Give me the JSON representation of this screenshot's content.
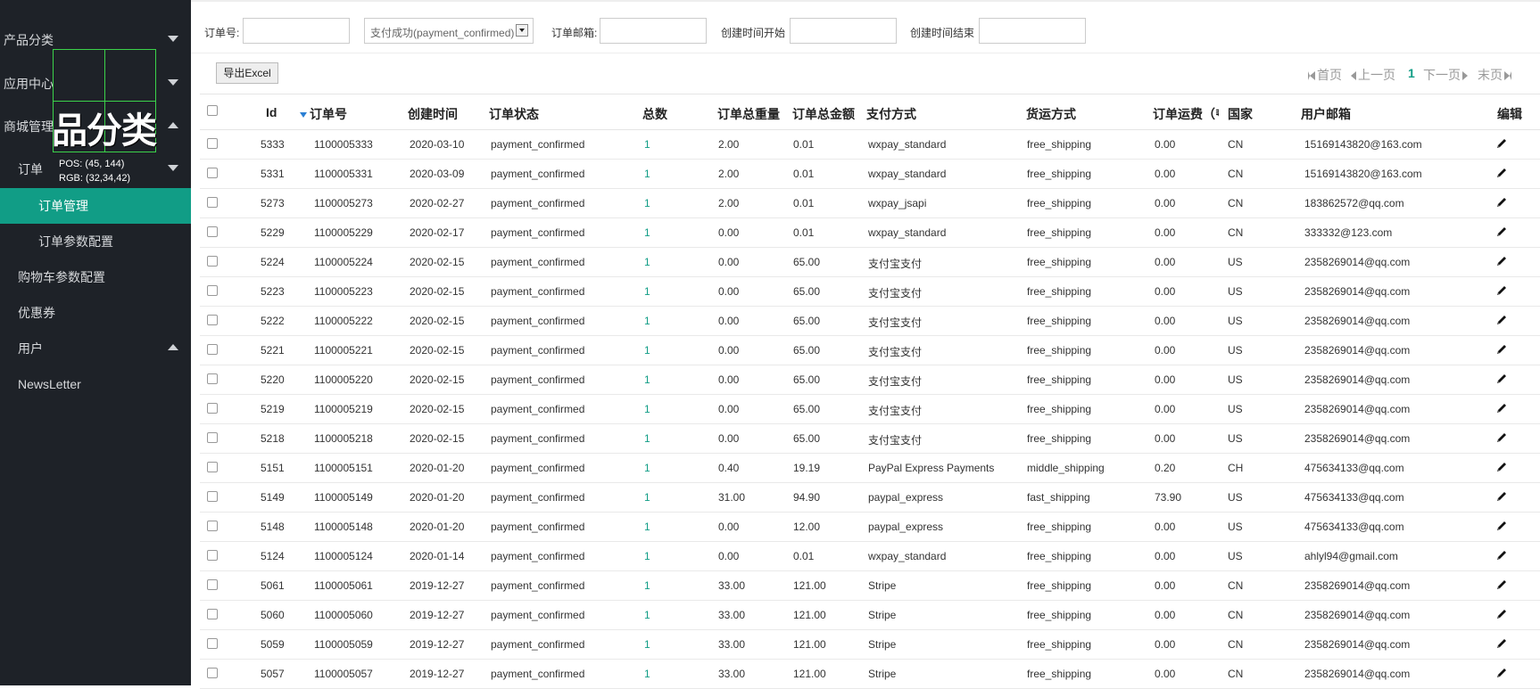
{
  "sidebar": {
    "items": [
      {
        "label": "产品分类",
        "caret": "down"
      },
      {
        "label": "应用中心",
        "caret": "down"
      },
      {
        "label": "商城管理",
        "caret": "up"
      },
      {
        "label": "订单",
        "caret": "down"
      },
      {
        "label": "订单管理",
        "active": true
      },
      {
        "label": "订单参数配置"
      },
      {
        "label": "购物车参数配置"
      },
      {
        "label": "优惠券"
      },
      {
        "label": "用户",
        "caret": "up"
      },
      {
        "label": "NewsLetter"
      }
    ]
  },
  "magnifier": {
    "zoom_text": "品分类",
    "pos": "POS:  (45, 144)",
    "rgb": "RGB:  (32,34,42)"
  },
  "filters": {
    "order_no_label": "订单号:",
    "status_value": "支付成功(payment_confirmed)",
    "email_label": "订单邮箱:",
    "start_label": "创建时间开始",
    "end_label": "创建时间结束"
  },
  "toolbar": {
    "export_label": "导出Excel",
    "first_label": "首页",
    "prev_label": "上一页",
    "current_page": "1",
    "next_label": "下一页",
    "last_label": "末页"
  },
  "table": {
    "headers": {
      "id": "Id",
      "order_no": "订单号",
      "created": "创建时间",
      "status": "订单状态",
      "count": "总数",
      "weight": "订单总重量",
      "amount": "订单总金额",
      "payment": "支付方式",
      "shipping": "货运方式",
      "fee": "订单运费（₹",
      "country": "国家",
      "email": "用户邮箱",
      "edit": "编辑"
    },
    "rows": [
      [
        "5333",
        "1100005333",
        "2020-03-10",
        "payment_confirmed",
        "1",
        "2.00",
        "0.01",
        "wxpay_standard",
        "free_shipping",
        "0.00",
        "CN",
        "15169143820@163.com"
      ],
      [
        "5331",
        "1100005331",
        "2020-03-09",
        "payment_confirmed",
        "1",
        "2.00",
        "0.01",
        "wxpay_standard",
        "free_shipping",
        "0.00",
        "CN",
        "15169143820@163.com"
      ],
      [
        "5273",
        "1100005273",
        "2020-02-27",
        "payment_confirmed",
        "1",
        "2.00",
        "0.01",
        "wxpay_jsapi",
        "free_shipping",
        "0.00",
        "CN",
        "183862572@qq.com"
      ],
      [
        "5229",
        "1100005229",
        "2020-02-17",
        "payment_confirmed",
        "1",
        "0.00",
        "0.01",
        "wxpay_standard",
        "free_shipping",
        "0.00",
        "CN",
        "333332@123.com"
      ],
      [
        "5224",
        "1100005224",
        "2020-02-15",
        "payment_confirmed",
        "1",
        "0.00",
        "65.00",
        "支付宝支付",
        "free_shipping",
        "0.00",
        "US",
        "2358269014@qq.com"
      ],
      [
        "5223",
        "1100005223",
        "2020-02-15",
        "payment_confirmed",
        "1",
        "0.00",
        "65.00",
        "支付宝支付",
        "free_shipping",
        "0.00",
        "US",
        "2358269014@qq.com"
      ],
      [
        "5222",
        "1100005222",
        "2020-02-15",
        "payment_confirmed",
        "1",
        "0.00",
        "65.00",
        "支付宝支付",
        "free_shipping",
        "0.00",
        "US",
        "2358269014@qq.com"
      ],
      [
        "5221",
        "1100005221",
        "2020-02-15",
        "payment_confirmed",
        "1",
        "0.00",
        "65.00",
        "支付宝支付",
        "free_shipping",
        "0.00",
        "US",
        "2358269014@qq.com"
      ],
      [
        "5220",
        "1100005220",
        "2020-02-15",
        "payment_confirmed",
        "1",
        "0.00",
        "65.00",
        "支付宝支付",
        "free_shipping",
        "0.00",
        "US",
        "2358269014@qq.com"
      ],
      [
        "5219",
        "1100005219",
        "2020-02-15",
        "payment_confirmed",
        "1",
        "0.00",
        "65.00",
        "支付宝支付",
        "free_shipping",
        "0.00",
        "US",
        "2358269014@qq.com"
      ],
      [
        "5218",
        "1100005218",
        "2020-02-15",
        "payment_confirmed",
        "1",
        "0.00",
        "65.00",
        "支付宝支付",
        "free_shipping",
        "0.00",
        "US",
        "2358269014@qq.com"
      ],
      [
        "5151",
        "1100005151",
        "2020-01-20",
        "payment_confirmed",
        "1",
        "0.40",
        "19.19",
        "PayPal Express Payments",
        "middle_shipping",
        "0.20",
        "CH",
        "475634133@qq.com"
      ],
      [
        "5149",
        "1100005149",
        "2020-01-20",
        "payment_confirmed",
        "1",
        "31.00",
        "94.90",
        "paypal_express",
        "fast_shipping",
        "73.90",
        "US",
        "475634133@qq.com"
      ],
      [
        "5148",
        "1100005148",
        "2020-01-20",
        "payment_confirmed",
        "1",
        "0.00",
        "12.00",
        "paypal_express",
        "free_shipping",
        "0.00",
        "US",
        "475634133@qq.com"
      ],
      [
        "5124",
        "1100005124",
        "2020-01-14",
        "payment_confirmed",
        "1",
        "0.00",
        "0.01",
        "wxpay_standard",
        "free_shipping",
        "0.00",
        "US",
        "ahlyl94@gmail.com"
      ],
      [
        "5061",
        "1100005061",
        "2019-12-27",
        "payment_confirmed",
        "1",
        "33.00",
        "121.00",
        "Stripe",
        "free_shipping",
        "0.00",
        "CN",
        "2358269014@qq.com"
      ],
      [
        "5060",
        "1100005060",
        "2019-12-27",
        "payment_confirmed",
        "1",
        "33.00",
        "121.00",
        "Stripe",
        "free_shipping",
        "0.00",
        "CN",
        "2358269014@qq.com"
      ],
      [
        "5059",
        "1100005059",
        "2019-12-27",
        "payment_confirmed",
        "1",
        "33.00",
        "121.00",
        "Stripe",
        "free_shipping",
        "0.00",
        "CN",
        "2358269014@qq.com"
      ],
      [
        "5057",
        "1100005057",
        "2019-12-27",
        "payment_confirmed",
        "1",
        "33.00",
        "121.00",
        "Stripe",
        "free_shipping",
        "0.00",
        "CN",
        "2358269014@qq.com"
      ]
    ]
  },
  "colors": {
    "sidebar_bg": "#1e2228",
    "accent": "#119d86",
    "magnifier": "#3bd24a"
  }
}
